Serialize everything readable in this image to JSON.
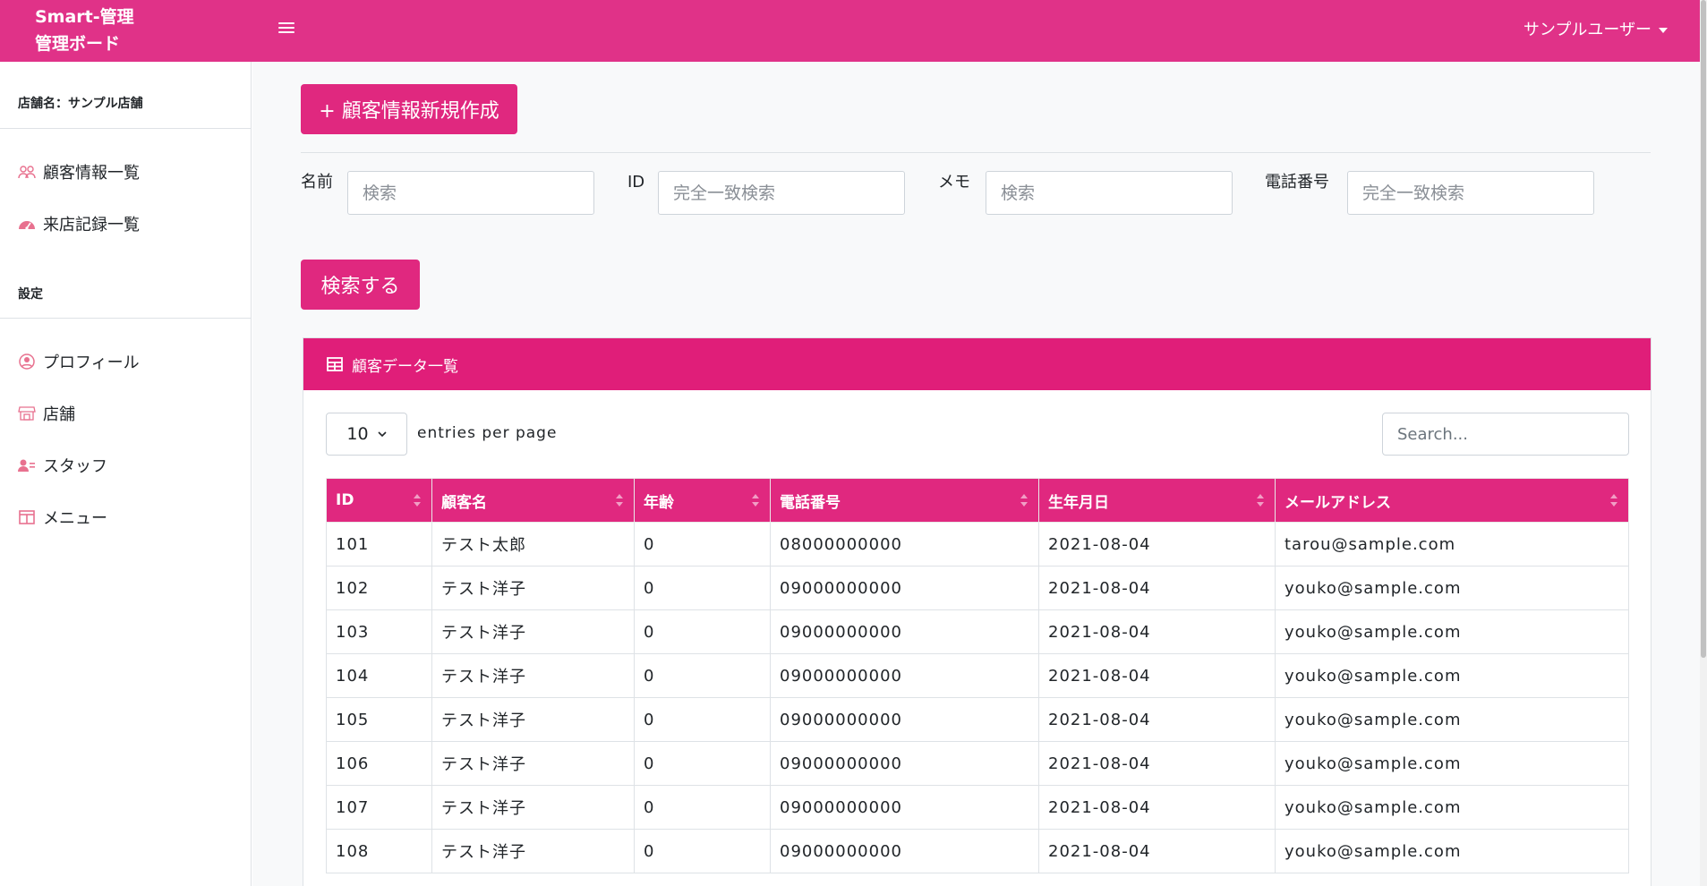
{
  "header": {
    "brand_line1": "Smart-管理",
    "brand_line2": "管理ボード",
    "user_name": "サンプルユーザー"
  },
  "sidebar": {
    "store_label": "店舗名：サンプル店舗",
    "items": [
      {
        "label": "顧客情報一覧",
        "icon": "users-icon"
      },
      {
        "label": "来店記録一覧",
        "icon": "gauge-icon"
      }
    ],
    "settings_label": "設定",
    "settings_items": [
      {
        "label": "プロフィール",
        "icon": "user-circle-icon"
      },
      {
        "label": "店舗",
        "icon": "store-icon"
      },
      {
        "label": "スタッフ",
        "icon": "staff-icon"
      },
      {
        "label": "メニュー",
        "icon": "columns-icon"
      }
    ]
  },
  "main": {
    "create_button": "+ 顧客情報新規作成",
    "filters": {
      "name_label": "名前",
      "name_placeholder": "検索",
      "id_label": "ID",
      "id_placeholder": "完全一致検索",
      "memo_label": "メモ",
      "memo_placeholder": "検索",
      "phone_label": "電話番号",
      "phone_placeholder": "完全一致検索"
    },
    "search_button": "検索する"
  },
  "card": {
    "title": "顧客データ一覧",
    "per_page_value": "10",
    "per_page_label": "entries per page",
    "search_placeholder": "Search..."
  },
  "table": {
    "columns": [
      "ID",
      "顧客名",
      "年齢",
      "電話番号",
      "生年月日",
      "メールアドレス"
    ],
    "rows": [
      [
        "101",
        "テスト太郎",
        "0",
        "08000000000",
        "2021-08-04",
        "tarou@sample.com"
      ],
      [
        "102",
        "テスト洋子",
        "0",
        "09000000000",
        "2021-08-04",
        "youko@sample.com"
      ],
      [
        "103",
        "テスト洋子",
        "0",
        "09000000000",
        "2021-08-04",
        "youko@sample.com"
      ],
      [
        "104",
        "テスト洋子",
        "0",
        "09000000000",
        "2021-08-04",
        "youko@sample.com"
      ],
      [
        "105",
        "テスト洋子",
        "0",
        "09000000000",
        "2021-08-04",
        "youko@sample.com"
      ],
      [
        "106",
        "テスト洋子",
        "0",
        "09000000000",
        "2021-08-04",
        "youko@sample.com"
      ],
      [
        "107",
        "テスト洋子",
        "0",
        "09000000000",
        "2021-08-04",
        "youko@sample.com"
      ],
      [
        "108",
        "テスト洋子",
        "0",
        "09000000000",
        "2021-08-04",
        "youko@sample.com"
      ]
    ]
  },
  "colors": {
    "accent": "#e03288",
    "button": "#e0287f",
    "card_header": "#e01e79",
    "icon": "#e8718f"
  }
}
